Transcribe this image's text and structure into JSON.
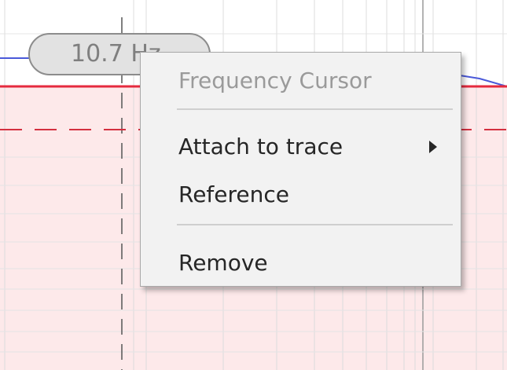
{
  "cursor_readout": {
    "value_text": "10.7 Hz"
  },
  "context_menu": {
    "header": "Frequency Cursor",
    "items": [
      {
        "label": "Attach to trace",
        "has_submenu": true
      },
      {
        "label": "Reference"
      },
      {
        "label": "Remove"
      }
    ]
  },
  "colors": {
    "plot_shaded_region": "#fde9ea",
    "trace_solid": "#e52a3e",
    "trace_dashed": "#d43040",
    "trace_blue": "#4a59d9",
    "grid_line": "#dcdcdc",
    "cursor_line": "#555555",
    "menu_background": "#f2f2f2"
  }
}
